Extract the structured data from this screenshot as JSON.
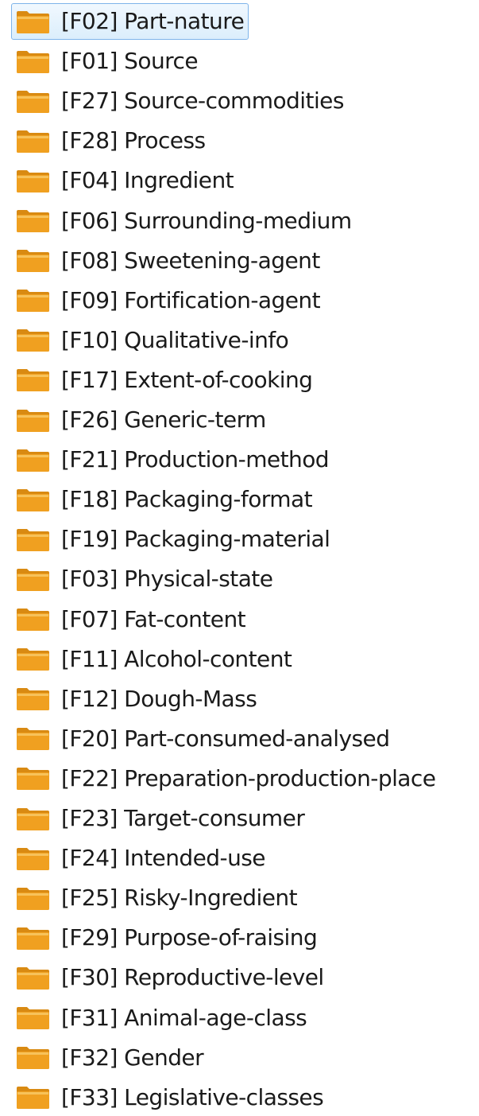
{
  "tree": {
    "selected_index": 0,
    "folder_color": "#f0a020",
    "items": [
      {
        "label": "[F02] Part-nature"
      },
      {
        "label": "[F01] Source"
      },
      {
        "label": "[F27] Source-commodities"
      },
      {
        "label": "[F28] Process"
      },
      {
        "label": "[F04] Ingredient"
      },
      {
        "label": "[F06] Surrounding-medium"
      },
      {
        "label": "[F08] Sweetening-agent"
      },
      {
        "label": "[F09] Fortification-agent"
      },
      {
        "label": "[F10] Qualitative-info"
      },
      {
        "label": "[F17] Extent-of-cooking"
      },
      {
        "label": "[F26] Generic-term"
      },
      {
        "label": "[F21] Production-method"
      },
      {
        "label": "[F18] Packaging-format"
      },
      {
        "label": "[F19] Packaging-material"
      },
      {
        "label": "[F03] Physical-state"
      },
      {
        "label": "[F07] Fat-content"
      },
      {
        "label": "[F11] Alcohol-content"
      },
      {
        "label": "[F12] Dough-Mass"
      },
      {
        "label": "[F20] Part-consumed-analysed"
      },
      {
        "label": "[F22] Preparation-production-place"
      },
      {
        "label": "[F23] Target-consumer"
      },
      {
        "label": "[F24] Intended-use"
      },
      {
        "label": "[F25] Risky-Ingredient"
      },
      {
        "label": "[F29] Purpose-of-raising"
      },
      {
        "label": "[F30] Reproductive-level"
      },
      {
        "label": "[F31] Animal-age-class"
      },
      {
        "label": "[F32] Gender"
      },
      {
        "label": "[F33] Legislative-classes"
      }
    ]
  }
}
